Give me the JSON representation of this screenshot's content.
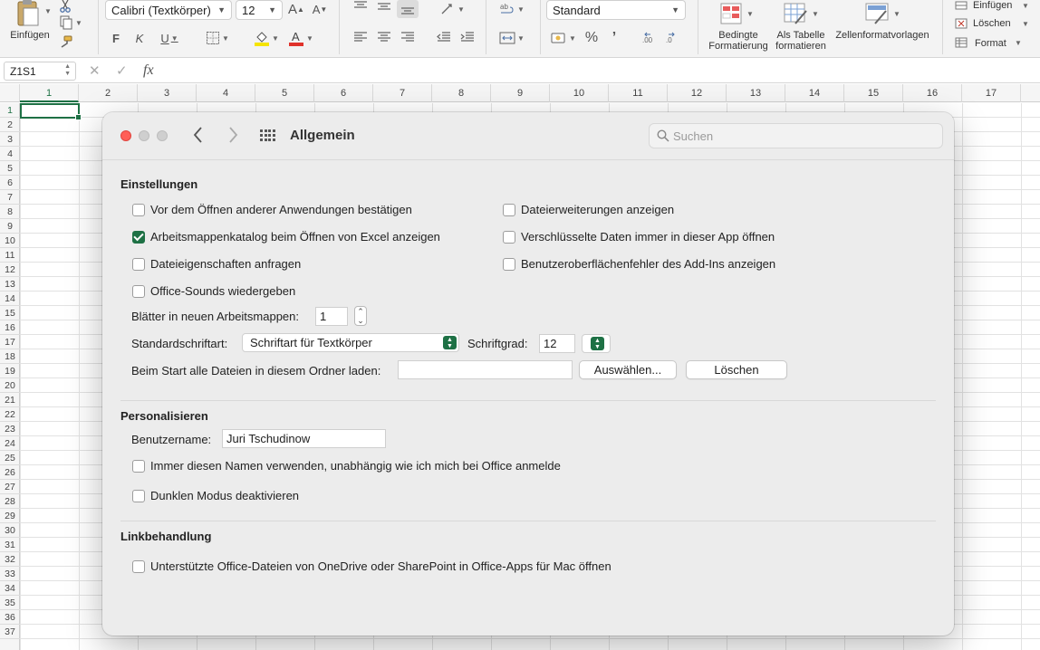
{
  "ribbon": {
    "paste_label": "Einfügen",
    "font_name": "Calibri (Textkörper)",
    "font_size": "12",
    "grow_font": "A",
    "shrink_font": "A",
    "bold": "F",
    "italic": "K",
    "underline": "U",
    "number_format": "Standard",
    "percent": "%",
    "comma": "’",
    "cond_format_line1": "Bedingte",
    "cond_format_line2": "Formatierung",
    "as_table_line1": "Als Tabelle",
    "as_table_line2": "formatieren",
    "cell_styles": "Zellenformatvorlagen",
    "insert": "Einfügen",
    "delete": "Löschen",
    "format": "Format",
    "accent_color": "#1e7145"
  },
  "formula_bar": {
    "name_box": "Z1S1",
    "fx": "fx"
  },
  "sheet": {
    "columns": [
      "1",
      "2",
      "3",
      "4",
      "5",
      "6",
      "7",
      "8",
      "9",
      "10",
      "11",
      "12",
      "13",
      "14",
      "15",
      "16",
      "17"
    ],
    "rows": [
      "1",
      "2",
      "3",
      "4",
      "5",
      "6",
      "7",
      "8",
      "9",
      "10",
      "11",
      "12",
      "13",
      "14",
      "15",
      "16",
      "17",
      "18",
      "19",
      "20",
      "21",
      "22",
      "23",
      "24",
      "25",
      "26",
      "27",
      "28",
      "29",
      "30",
      "31",
      "32",
      "33",
      "34",
      "35",
      "36",
      "37"
    ]
  },
  "dialog": {
    "title": "Allgemein",
    "search_placeholder": "Suchen",
    "sections": {
      "settings": "Einstellungen",
      "personalize": "Personalisieren",
      "links": "Linkbehandlung"
    },
    "checkboxes": {
      "confirm_open": {
        "label": "Vor dem Öffnen anderer Anwendungen bestätigen",
        "checked": false
      },
      "show_gallery": {
        "label": "Arbeitsmappenkatalog beim Öffnen von Excel anzeigen",
        "checked": true
      },
      "ask_properties": {
        "label": "Dateieigenschaften anfragen",
        "checked": false
      },
      "office_sounds": {
        "label": "Office-Sounds wiedergeben",
        "checked": false
      },
      "show_extensions": {
        "label": "Dateierweiterungen anzeigen",
        "checked": false
      },
      "encrypted_in_app": {
        "label": "Verschlüsselte Daten immer in dieser App öffnen",
        "checked": false
      },
      "addin_errors": {
        "label": "Benutzeroberflächenfehler des Add-Ins anzeigen",
        "checked": false
      },
      "always_use_name": {
        "label": "Immer diesen Namen verwenden, unabhängig wie ich mich bei Office anmelde",
        "checked": false
      },
      "disable_dark": {
        "label": "Dunklen Modus deaktivieren",
        "checked": false
      },
      "open_onedrive": {
        "label": "Unterstützte Office-Dateien von OneDrive oder SharePoint in Office-Apps für Mac öffnen",
        "checked": false
      }
    },
    "sheets_label": "Blätter in neuen Arbeitsmappen:",
    "sheets_value": "1",
    "default_font_label": "Standardschriftart:",
    "default_font_value": "Schriftart für Textkörper",
    "font_size_label": "Schriftgrad:",
    "font_size_value": "12",
    "startup_folder_label": "Beim Start alle Dateien in diesem Ordner laden:",
    "startup_folder_value": "",
    "choose_button": "Auswählen...",
    "clear_button": "Löschen",
    "username_label": "Benutzername:",
    "username_value": "Juri Tschudinow"
  }
}
